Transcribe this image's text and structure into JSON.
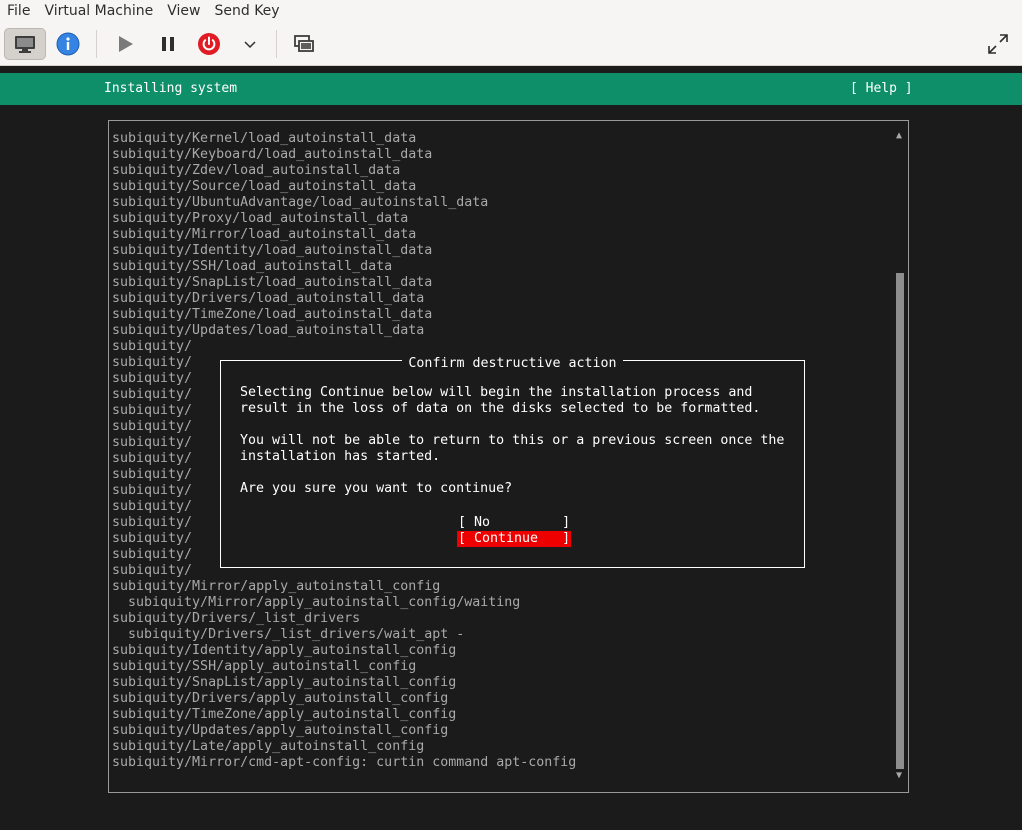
{
  "menu": [
    "File",
    "Virtual Machine",
    "View",
    "Send Key"
  ],
  "toolbar": {
    "icons": [
      "monitor-icon",
      "info-icon",
      "play-icon",
      "pause-icon",
      "power-icon",
      "chevron-down-icon",
      "screens-icon",
      "fullscreen-icon"
    ],
    "colors": {
      "info": "#3584e4",
      "power": "#e01b24"
    }
  },
  "header": {
    "title": "Installing system",
    "help": "[ Help ]",
    "color": "#0e8f6a"
  },
  "log": {
    "lines": [
      "subiquity/Kernel/load_autoinstall_data",
      "subiquity/Keyboard/load_autoinstall_data",
      "subiquity/Zdev/load_autoinstall_data",
      "subiquity/Source/load_autoinstall_data",
      "subiquity/UbuntuAdvantage/load_autoinstall_data",
      "subiquity/Proxy/load_autoinstall_data",
      "subiquity/Mirror/load_autoinstall_data",
      "subiquity/Identity/load_autoinstall_data",
      "subiquity/SSH/load_autoinstall_data",
      "subiquity/SnapList/load_autoinstall_data",
      "subiquity/Drivers/load_autoinstall_data",
      "subiquity/TimeZone/load_autoinstall_data",
      "subiquity/Updates/load_autoinstall_data",
      "subiquity/",
      "subiquity/",
      "subiquity/",
      "subiquity/",
      "subiquity/",
      "subiquity/",
      "subiquity/",
      "subiquity/",
      "subiquity/",
      "subiquity/",
      "subiquity/",
      "subiquity/",
      "subiquity/",
      "subiquity/",
      "subiquity/",
      "subiquity/Mirror/apply_autoinstall_config",
      "  subiquity/Mirror/apply_autoinstall_config/waiting",
      "subiquity/Drivers/_list_drivers",
      "  subiquity/Drivers/_list_drivers/wait_apt -",
      "subiquity/Identity/apply_autoinstall_config",
      "subiquity/SSH/apply_autoinstall_config",
      "subiquity/SnapList/apply_autoinstall_config",
      "subiquity/Drivers/apply_autoinstall_config",
      "subiquity/TimeZone/apply_autoinstall_config",
      "subiquity/Updates/apply_autoinstall_config",
      "subiquity/Late/apply_autoinstall_config",
      "subiquity/Mirror/cmd-apt-config: curtin command apt-config"
    ],
    "scroll_up": "▲",
    "scroll_down": "▼"
  },
  "dialog": {
    "title": "Confirm destructive action",
    "text": "Selecting Continue below will begin the installation process and\nresult in the loss of data on the disks selected to be formatted.\n\nYou will not be able to return to this or a previous screen once the\ninstallation has started.\n\nAre you sure you want to continue?",
    "no_label": "[ No         ]",
    "continue_label": "[ Continue   ]",
    "continue_color": "#ee0000"
  }
}
